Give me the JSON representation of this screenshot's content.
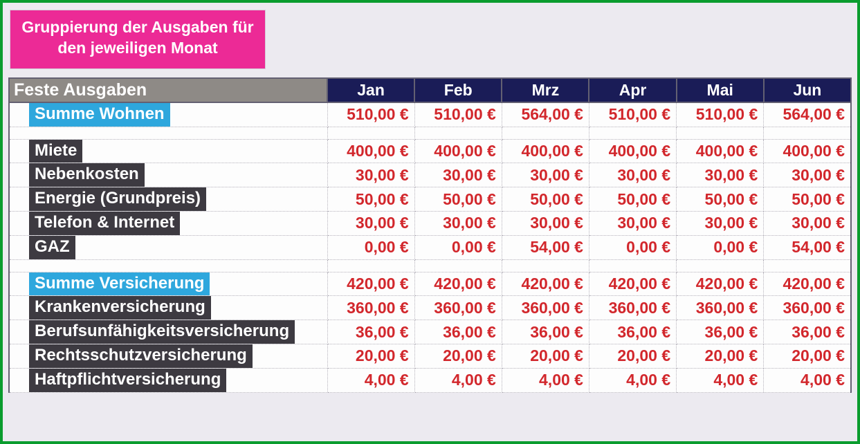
{
  "title": "Gruppierung der Ausgaben für den jeweiligen Monat",
  "header": {
    "category": "Feste Ausgaben",
    "months": [
      "Jan",
      "Feb",
      "Mrz",
      "Apr",
      "Mai",
      "Jun"
    ]
  },
  "rows": [
    {
      "type": "sum",
      "label": "Summe Wohnen",
      "values": [
        "510,00 €",
        "510,00 €",
        "564,00 €",
        "510,00 €",
        "510,00 €",
        "564,00 €"
      ]
    },
    {
      "type": "spacer"
    },
    {
      "type": "item",
      "label": "Miete",
      "values": [
        "400,00 €",
        "400,00 €",
        "400,00 €",
        "400,00 €",
        "400,00 €",
        "400,00 €"
      ]
    },
    {
      "type": "item",
      "label": "Nebenkosten",
      "values": [
        "30,00 €",
        "30,00 €",
        "30,00 €",
        "30,00 €",
        "30,00 €",
        "30,00 €"
      ]
    },
    {
      "type": "item",
      "label": "Energie (Grundpreis)",
      "values": [
        "50,00 €",
        "50,00 €",
        "50,00 €",
        "50,00 €",
        "50,00 €",
        "50,00 €"
      ]
    },
    {
      "type": "item",
      "label": "Telefon & Internet",
      "values": [
        "30,00 €",
        "30,00 €",
        "30,00 €",
        "30,00 €",
        "30,00 €",
        "30,00 €"
      ]
    },
    {
      "type": "item",
      "label": "GAZ",
      "values": [
        "0,00 €",
        "0,00 €",
        "54,00 €",
        "0,00 €",
        "0,00 €",
        "54,00 €"
      ]
    },
    {
      "type": "spacer"
    },
    {
      "type": "sum",
      "label": "Summe Versicherung",
      "values": [
        "420,00 €",
        "420,00 €",
        "420,00 €",
        "420,00 €",
        "420,00 €",
        "420,00 €"
      ]
    },
    {
      "type": "item",
      "label": "Krankenversicherung",
      "values": [
        "360,00 €",
        "360,00 €",
        "360,00 €",
        "360,00 €",
        "360,00 €",
        "360,00 €"
      ]
    },
    {
      "type": "item",
      "label": "Berufsunfähigkeitsversicherung",
      "values": [
        "36,00 €",
        "36,00 €",
        "36,00 €",
        "36,00 €",
        "36,00 €",
        "36,00 €"
      ]
    },
    {
      "type": "item",
      "label": "Rechtsschutzversicherung",
      "values": [
        "20,00 €",
        "20,00 €",
        "20,00 €",
        "20,00 €",
        "20,00 €",
        "20,00 €"
      ]
    },
    {
      "type": "item",
      "label": "Haftpflichtversicherung",
      "values": [
        "4,00 €",
        "4,00 €",
        "4,00 €",
        "4,00 €",
        "4,00 €",
        "4,00 €"
      ]
    }
  ]
}
